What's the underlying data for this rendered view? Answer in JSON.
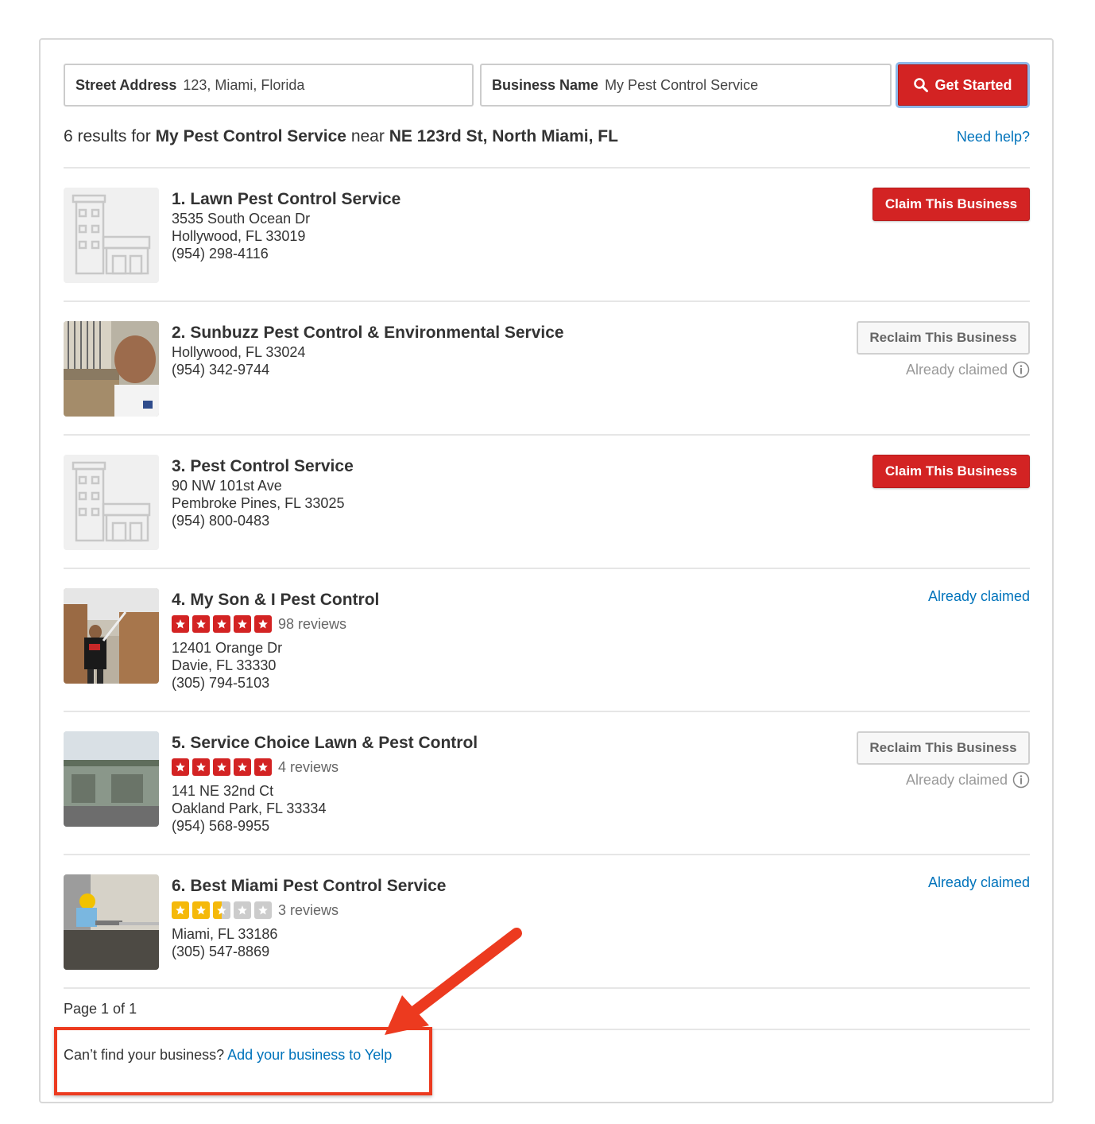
{
  "search": {
    "address_label": "Street Address",
    "address_value": "123, Miami, Florida",
    "business_label": "Business Name",
    "business_value": "My Pest Control Service",
    "button_label": "Get Started"
  },
  "summary": {
    "prefix": "6 results for",
    "query": "My Pest Control Service",
    "near_word": "near",
    "location": "NE 123rd St, North Miami, FL",
    "help_link": "Need help?"
  },
  "results": [
    {
      "name": "1. Lawn Pest Control Service",
      "address1": "3535 South Ocean Dr",
      "address2": "Hollywood, FL 33019",
      "phone": "(954) 298-4116",
      "action": "Claim This Business"
    },
    {
      "name": "2. Sunbuzz Pest Control & Environmental Service",
      "address1": "Hollywood, FL 33024",
      "phone": "(954) 342-9744",
      "action": "Reclaim This Business",
      "note": "Already claimed"
    },
    {
      "name": "3. Pest Control Service",
      "address1": "90 NW 101st Ave",
      "address2": "Pembroke Pines, FL 33025",
      "phone": "(954) 800-0483",
      "action": "Claim This Business"
    },
    {
      "name": "4. My Son & I Pest Control",
      "rating": 5,
      "reviews": "98 reviews",
      "address1": "12401 Orange Dr",
      "address2": "Davie, FL 33330",
      "phone": "(305) 794-5103",
      "action": "Already claimed"
    },
    {
      "name": "5. Service Choice Lawn & Pest Control",
      "rating": 5,
      "reviews": "4 reviews",
      "address1": "141 NE 32nd Ct",
      "address2": "Oakland Park, FL 33334",
      "phone": "(954) 568-9955",
      "action": "Reclaim This Business",
      "note": "Already claimed"
    },
    {
      "name": "6. Best Miami Pest Control Service",
      "rating": 2.5,
      "reviews": "3 reviews",
      "address1": "Miami, FL 33186",
      "phone": "(305) 547-8869",
      "action": "Already claimed"
    }
  ],
  "pager": "Page 1 of 1",
  "footer": {
    "question": "Can’t find your business?",
    "link": "Add your business to Yelp"
  },
  "colors": {
    "brand_red": "#d32323",
    "link_blue": "#0073bb",
    "star_red": "#d32323",
    "star_yellow": "#f5b90a",
    "annotation_red": "#ec3a1f"
  }
}
